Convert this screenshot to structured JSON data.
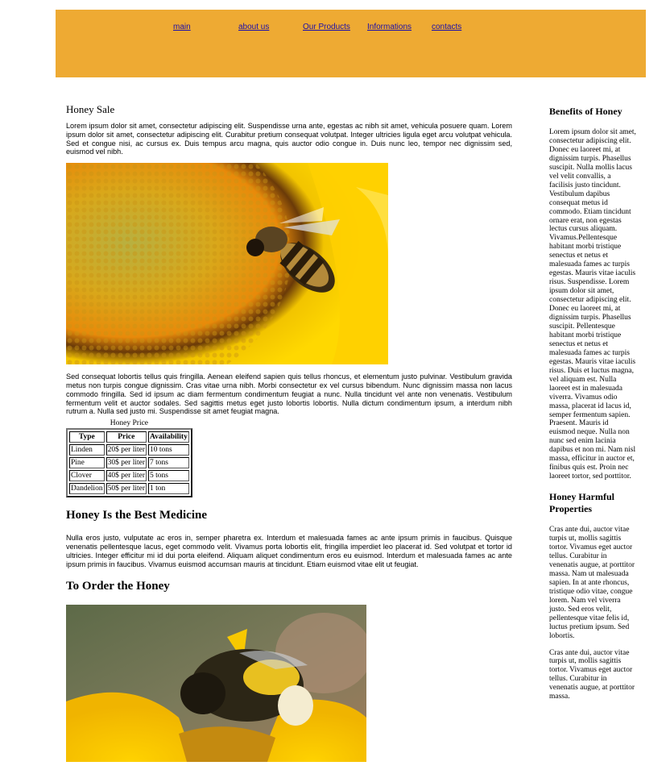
{
  "nav": {
    "items": [
      "main",
      "about us",
      "Our Products",
      "Informations",
      "contacts"
    ]
  },
  "colors": {
    "header_bg": "#eeaa33",
    "link": "#1a0dab"
  },
  "main": {
    "title": "Honey Sale",
    "intro": "Lorem ipsum dolor sit amet, consectetur adipiscing elit. Suspendisse urna ante, egestas ac nibh sit amet, vehicula posuere quam. Lorem ipsum dolor sit amet, consectetur adipiscing elit. Curabitur pretium consequat volutpat. Integer ultricies ligula eget arcu volutpat vehicula. Sed et congue nisi, ac cursus ex. Duis tempus arcu magna, quis auctor odio congue in. Duis nunc leo, tempor nec dignissim sed, euismod vel nibh.",
    "image1": "bee-on-sunflower-photo",
    "para2": "Sed consequat lobortis tellus quis fringilla. Aenean eleifend sapien quis tellus rhoncus, et elementum justo pulvinar. Vestibulum gravida metus non turpis congue dignissim. Cras vitae urna nibh. Morbi consectetur ex vel cursus bibendum. Nunc dignissim massa non lacus commodo fringilla. Sed id ipsum ac diam fermentum condimentum feugiat a nunc. Nulla tincidunt vel ante non venenatis. Vestibulum fermentum velit et auctor sodales. Sed sagittis metus eget justo lobortis lobortis. Nulla dictum condimentum ipsum, a interdum nibh rutrum a. Nulla sed justo mi. Suspendisse sit amet feugiat magna.",
    "table": {
      "caption": "Honey Price",
      "headers": [
        "Type",
        "Price",
        "Availability"
      ],
      "rows": [
        [
          "Linden",
          "20$ per liter",
          "10 tons"
        ],
        [
          "Pine",
          "30$ per liter",
          "7 tons"
        ],
        [
          "Clover",
          "40$ per liter",
          "5 tons"
        ],
        [
          "Dandelion",
          "50$ per liter",
          "1 ton"
        ]
      ]
    },
    "heading2": "Honey Is the Best Medicine",
    "para3": "Nulla eros justo, vulputate ac eros in, semper pharetra ex. Interdum et malesuada fames ac ante ipsum primis in faucibus. Quisque venenatis pellentesque lacus, eget commodo velit. Vivamus porta lobortis elit, fringilla imperdiet leo placerat id. Sed volutpat et tortor id ultricies. Integer efficitur mi id dui porta eleifend. Aliquam aliquet condimentum eros eu euismod. Interdum et malesuada fames ac ante ipsum primis in faucibus. Vivamus euismod accumsan mauris at tincidunt. Etiam euismod vitae elit ut feugiat.",
    "heading3": "To Order the Honey",
    "image2": "bumblebee-on-flower-photo"
  },
  "sidebar": {
    "heading1": "Benefits of Honey",
    "text1": "Lorem ipsum dolor sit amet, consectetur adipiscing elit. Donec eu laoreet mi, at dignissim turpis. Phasellus suscipit. Nulla mollis lacus vel velit convallis, a facilisis justo tincidunt. Vestibulum dapibus consequat metus id commodo. Etiam tincidunt ornare erat, non egestas lectus cursus aliquam. Vivamus.Pellentesque habitant morbi tristique senectus et netus et malesuada fames ac turpis egestas. Mauris vitae iaculis risus. Suspendisse. Lorem ipsum dolor sit amet, consectetur adipiscing elit. Donec eu laoreet mi, at dignissim turpis. Phasellus suscipit. Pellentesque habitant morbi tristique senectus et netus et malesuada fames ac turpis egestas. Mauris vitae iaculis risus. Duis et luctus magna, vel aliquam est. Nulla laoreet est in malesuada viverra. Vivamus odio massa, placerat id lacus id, semper fermentum sapien. Praesent. Mauris id euismod neque. Nulla non nunc sed enim lacinia dapibus et non mi. Nam nisl massa, efficitur in auctor et, finibus quis est. Proin nec laoreet tortor, sed porttitor.",
    "heading2": "Honey Harmful Properties",
    "text2": "Cras ante dui, auctor vitae turpis ut, mollis sagittis tortor. Vivamus eget auctor tellus. Curabitur in venenatis augue, at porttitor massa. Nam ut malesuada sapien. In at ante rhoncus, tristique odio vitae, congue lorem. Nam vel viverra justo. Sed eros velit, pellentesque vitae felis id, luctus pretium ipsum. Sed lobortis.",
    "text3": "Cras ante dui, auctor vitae turpis ut, mollis sagittis tortor. Vivamus eget auctor tellus. Curabitur in venenatis augue, at porttitor massa."
  }
}
